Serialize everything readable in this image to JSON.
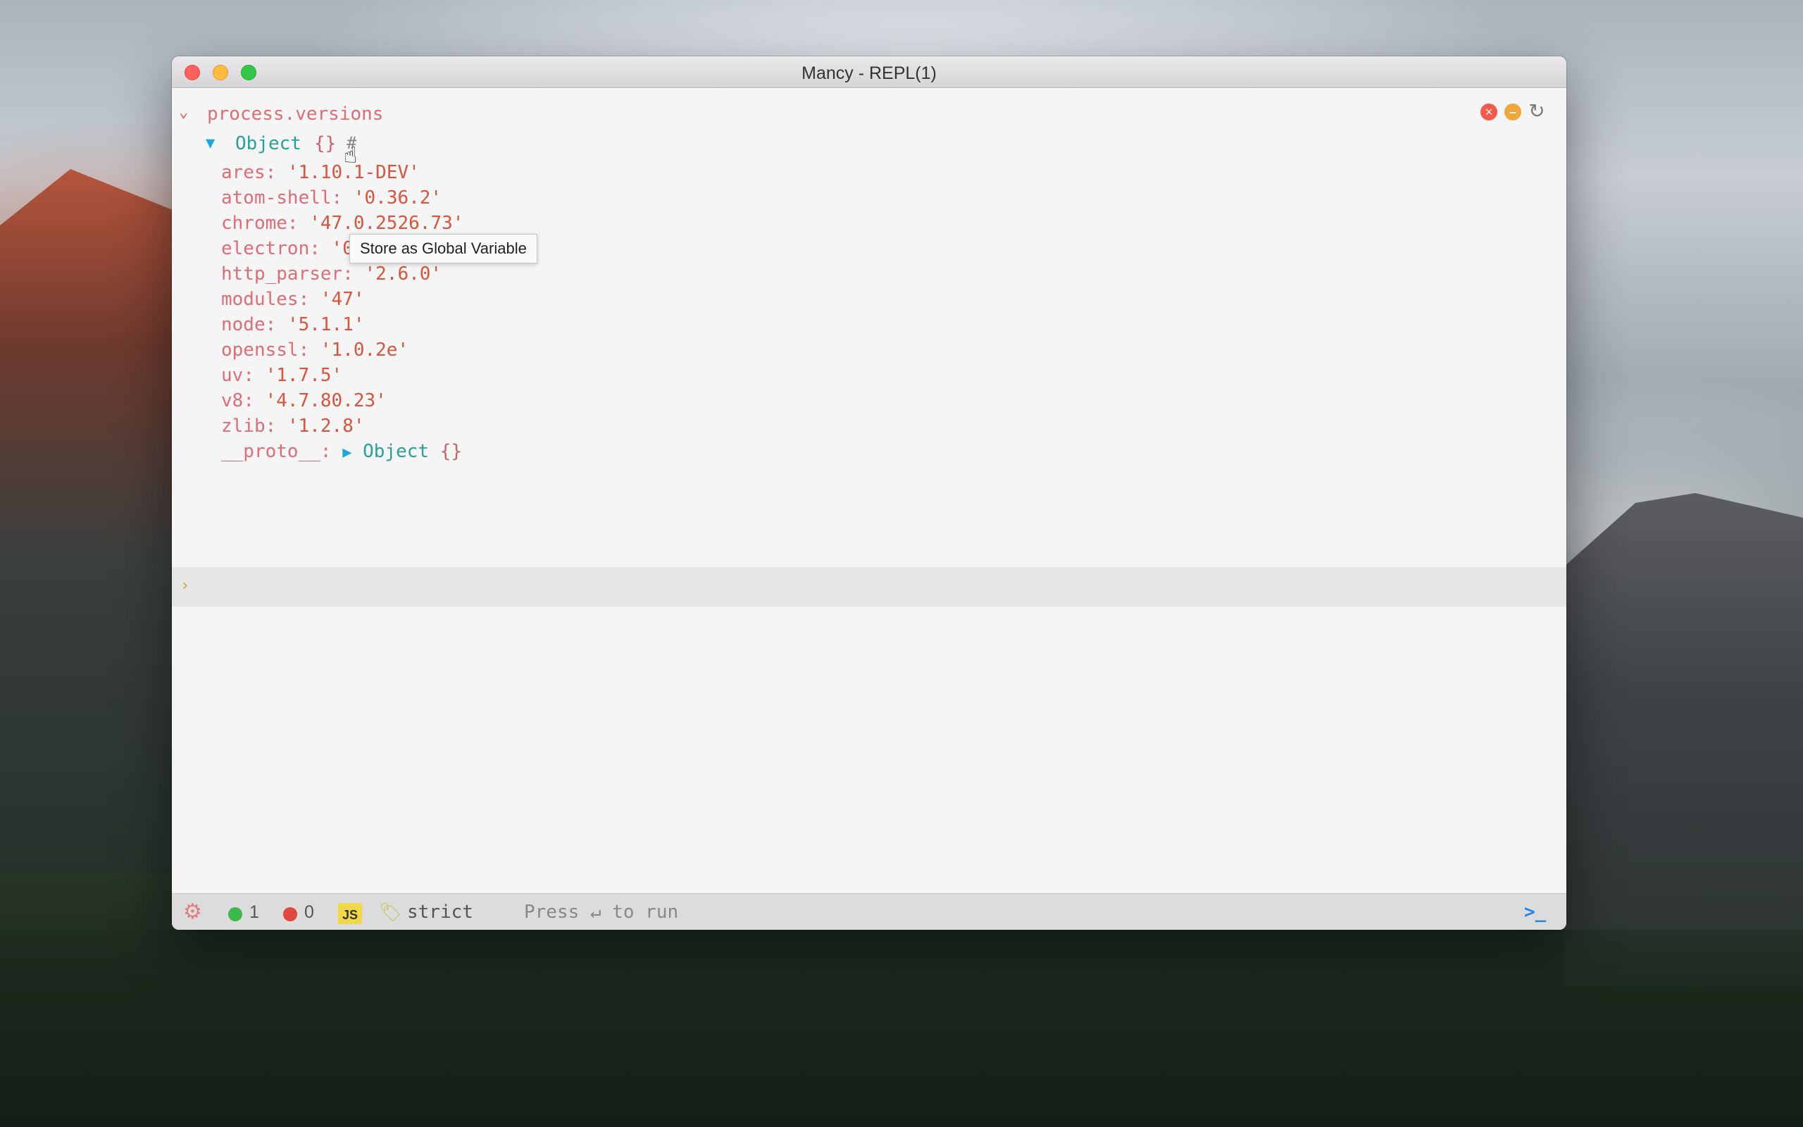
{
  "window": {
    "title": "Mancy - REPL(1)"
  },
  "command": {
    "text": "process.versions"
  },
  "result": {
    "object_name": "Object",
    "object_braces": "{}",
    "hash_symbol": "#",
    "tooltip": "Store as Global Variable",
    "properties": [
      {
        "key": "ares",
        "value": "'1.10.1-DEV'"
      },
      {
        "key": "atom-shell",
        "value": "'0.36.2'"
      },
      {
        "key": "chrome",
        "value": "'47.0.2526.73'"
      },
      {
        "key": "electron",
        "value": "'0.36.2'"
      },
      {
        "key": "http_parser",
        "value": "'2.6.0'"
      },
      {
        "key": "modules",
        "value": "'47'"
      },
      {
        "key": "node",
        "value": "'5.1.1'"
      },
      {
        "key": "openssl",
        "value": "'1.0.2e'"
      },
      {
        "key": "uv",
        "value": "'1.7.5'"
      },
      {
        "key": "v8",
        "value": "'4.7.80.23'"
      },
      {
        "key": "zlib",
        "value": "'1.2.8'"
      }
    ],
    "proto_key": "__proto__:",
    "proto_name": "Object",
    "proto_braces": "{}"
  },
  "prompt": {
    "arrow": "›",
    "value": ""
  },
  "statusbar": {
    "success_count": "1",
    "error_count": "0",
    "lang_badge": "JS",
    "mode": "strict",
    "hint": "Press ↵ to run",
    "terminal_glyph": ">_"
  },
  "colors": {
    "key": "#e06c75",
    "string_value": "#d9543c",
    "object_type": "#2aa198",
    "triangle": "#1aa6e0",
    "success": "#3cb94a",
    "error": "#e0473e",
    "js_badge": "#f0d84a"
  },
  "icons": {
    "collapse": "chevron-down-icon",
    "clear": "close-circle-icon",
    "collapse_all": "minus-circle-icon",
    "reload": "reload-icon",
    "settings": "gear-icon",
    "mode": "tag-icon",
    "terminal": "terminal-icon"
  }
}
